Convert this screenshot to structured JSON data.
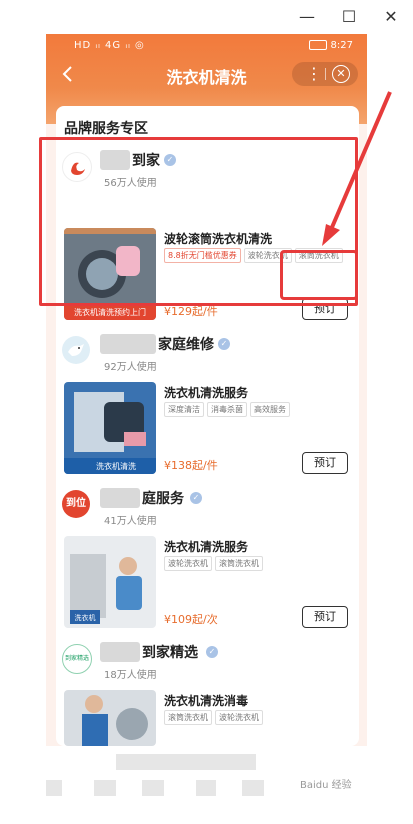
{
  "window": {
    "minimize": "—",
    "maximize": "☐",
    "close": "✕"
  },
  "status_bar": {
    "left": "HD ᵢₗ 4G ᵢₗ ◎",
    "time": "8:27"
  },
  "header": {
    "title": "洗衣机清洗"
  },
  "section": {
    "title": "品牌服务专区"
  },
  "brands": [
    {
      "name": "到家",
      "users": "56万人使用"
    },
    {
      "name": "家庭维修",
      "users": "92万人使用"
    },
    {
      "name": "庭服务",
      "users": "41万人使用",
      "logo_text": "到位"
    },
    {
      "name": "到家精选",
      "users": "18万人使用",
      "logo_text": "到家精选"
    }
  ],
  "products": [
    {
      "name": "波轮滚筒洗衣机清洗",
      "tags": [
        "8.8折无门槛优惠券",
        "波轮洗衣机",
        "滚筒洗衣机"
      ],
      "price": "¥129起/件",
      "book": "预订",
      "thumb_text": "洗衣机清洗预约上门"
    },
    {
      "name": "洗衣机清洗服务",
      "tags": [
        "深度清洁",
        "消毒杀菌",
        "高效服务"
      ],
      "price": "¥138起/件",
      "book": "预订",
      "thumb_text": "洗衣机清洗"
    },
    {
      "name": "洗衣机清洗服务",
      "tags": [
        "波轮洗衣机",
        "滚筒洗衣机"
      ],
      "price": "¥109起/次",
      "book": "预订",
      "thumb_text": "洗衣机"
    },
    {
      "name": "洗衣机清洗消毒",
      "tags": [
        "滚筒洗衣机",
        "波轮洗衣机"
      ]
    }
  ],
  "colors": {
    "header": "#f27a3c",
    "annotation": "#e63b3b",
    "price": "#e76c2d"
  },
  "watermark": "Baidu 经验"
}
